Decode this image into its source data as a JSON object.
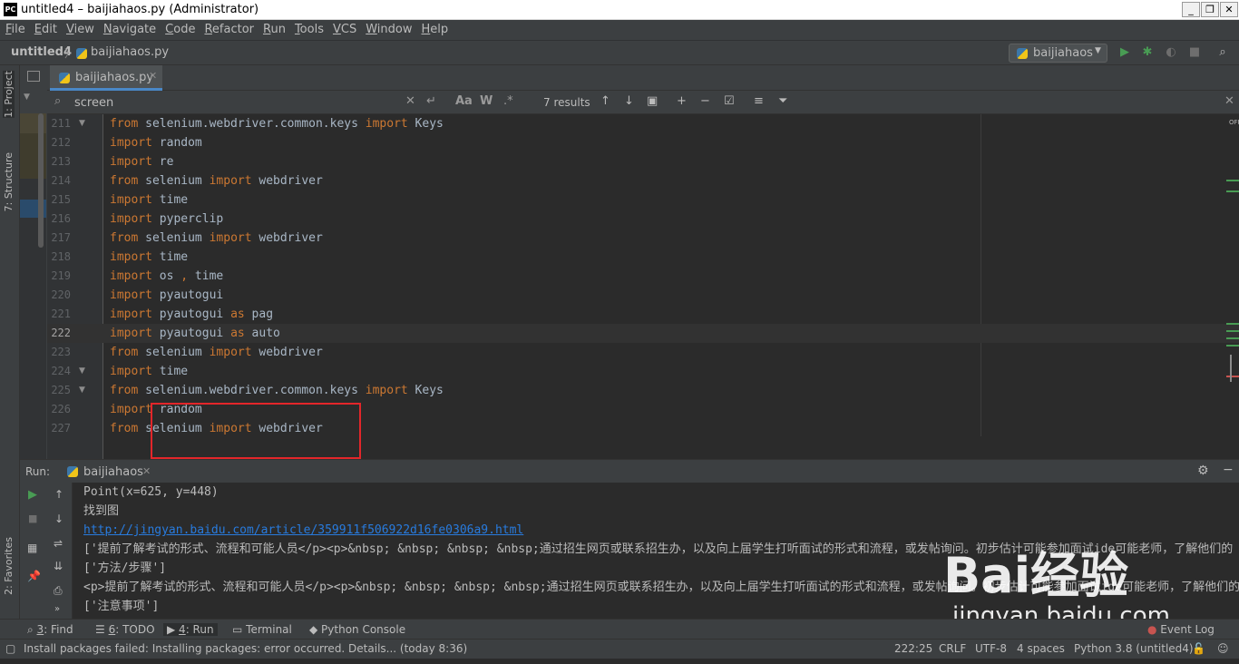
{
  "window": {
    "title": "untitled4 – baijiahaos.py (Administrator)",
    "logo_text": "PC",
    "controls": [
      "_",
      "❐",
      "✕"
    ]
  },
  "menu": [
    {
      "label": "File",
      "u": "F",
      "rest": "ile"
    },
    {
      "label": "Edit",
      "u": "E",
      "rest": "dit"
    },
    {
      "label": "View",
      "u": "V",
      "rest": "iew"
    },
    {
      "label": "Navigate",
      "u": "N",
      "rest": "avigate"
    },
    {
      "label": "Code",
      "u": "C",
      "rest": "ode"
    },
    {
      "label": "Refactor",
      "u": "R",
      "rest": "efactor"
    },
    {
      "label": "Run",
      "u": "R",
      "rest": "un"
    },
    {
      "label": "Tools",
      "u": "T",
      "rest": "ools"
    },
    {
      "label": "VCS",
      "u": "V",
      "rest": "CS"
    },
    {
      "label": "Window",
      "u": "W",
      "rest": "indow"
    },
    {
      "label": "Help",
      "u": "H",
      "rest": "elp"
    }
  ],
  "nav": {
    "project": "untitled4",
    "file": "baijiahaos.py",
    "run_config": "baijiahaos"
  },
  "left_strip": {
    "project_tab": "1: Project",
    "structure_tab": "7: Structure",
    "favorites_tab": "2: Favorites"
  },
  "editor_tab": {
    "label": "baijiahaos.py"
  },
  "search": {
    "query": "screen",
    "results": "7 results",
    "match_case": "Aa",
    "words": "W",
    "regex": ".*"
  },
  "editor": {
    "current_line": 222,
    "off_label": "OFF",
    "lines": [
      {
        "n": "211",
        "parts": [
          [
            "from",
            1
          ],
          [
            " selenium.webdriver.common.keys ",
            0
          ],
          [
            "import",
            1
          ],
          [
            " Keys",
            0
          ]
        ]
      },
      {
        "n": "212",
        "parts": [
          [
            "import",
            1
          ],
          [
            " random",
            0
          ]
        ]
      },
      {
        "n": "213",
        "parts": [
          [
            "import",
            1
          ],
          [
            " re",
            0
          ]
        ]
      },
      {
        "n": "214",
        "parts": [
          [
            "from",
            1
          ],
          [
            " selenium ",
            0
          ],
          [
            "import",
            1
          ],
          [
            " webdriver",
            0
          ]
        ]
      },
      {
        "n": "215",
        "parts": [
          [
            "import",
            1
          ],
          [
            " time",
            0
          ]
        ]
      },
      {
        "n": "216",
        "parts": [
          [
            "import",
            1
          ],
          [
            " pyperclip",
            0
          ]
        ]
      },
      {
        "n": "217",
        "parts": [
          [
            "from",
            1
          ],
          [
            " selenium ",
            0
          ],
          [
            "import",
            1
          ],
          [
            " webdriver",
            0
          ]
        ]
      },
      {
        "n": "218",
        "parts": [
          [
            "import",
            1
          ],
          [
            " time",
            0
          ]
        ]
      },
      {
        "n": "219",
        "parts": [
          [
            "import",
            1
          ],
          [
            " os ",
            0
          ],
          [
            ",",
            1
          ],
          [
            " time",
            0
          ]
        ]
      },
      {
        "n": "220",
        "parts": [
          [
            "import",
            1
          ],
          [
            " pyautogui",
            0
          ]
        ]
      },
      {
        "n": "221",
        "parts": [
          [
            "import",
            1
          ],
          [
            " pyautogui ",
            0
          ],
          [
            "as",
            1
          ],
          [
            " pag",
            0
          ]
        ]
      },
      {
        "n": "222",
        "parts": [
          [
            "import",
            1
          ],
          [
            " pyautogui ",
            0
          ],
          [
            "as",
            1
          ],
          [
            " auto",
            0
          ]
        ]
      },
      {
        "n": "223",
        "parts": [
          [
            "from",
            1
          ],
          [
            " selenium ",
            0
          ],
          [
            "import",
            1
          ],
          [
            " webdriver",
            0
          ]
        ]
      },
      {
        "n": "224",
        "parts": [
          [
            "import",
            1
          ],
          [
            " time",
            0
          ]
        ]
      },
      {
        "n": "225",
        "parts": [
          [
            "from",
            1
          ],
          [
            " selenium.webdriver.common.keys ",
            0
          ],
          [
            "import",
            1
          ],
          [
            " Keys",
            0
          ]
        ]
      },
      {
        "n": "226",
        "parts": [
          [
            "import",
            1
          ],
          [
            " random",
            0
          ]
        ]
      },
      {
        "n": "227",
        "parts": [
          [
            "from",
            1
          ],
          [
            " selenium ",
            0
          ],
          [
            "import",
            1
          ],
          [
            " webdriver",
            0
          ]
        ]
      }
    ]
  },
  "run": {
    "label": "Run:",
    "tab": "baijiahaos",
    "console": [
      {
        "text": "Point(x=625, y=448)",
        "link": false
      },
      {
        "text": "找到图",
        "link": false
      },
      {
        "text": "http://jingyan.baidu.com/article/359911f506922d16fe0306a9.html",
        "link": true
      },
      {
        "text": "['提前了解考试的形式、流程和可能人员</p><p>&nbsp; &nbsp; &nbsp; &nbsp;通过招生网页或联系招生办，以及向上届学生打听面试的形式和流程，或发帖询问。初步估计可能参加面试ide可能老师，了解他们的",
        "link": false
      },
      {
        "text": "['方法/步骤']",
        "link": false
      },
      {
        "text": "<p>提前了解考试的形式、流程和可能人员</p><p>&nbsp; &nbsp; &nbsp; &nbsp;通过招生网页或联系招生办，以及向上届学生打听面试的形式和流程，或发帖询问。初步估计可能参加面试ide可能老师，了解他们的",
        "link": false
      },
      {
        "text": "['注意事项']",
        "link": false
      }
    ]
  },
  "bottom_tabs": [
    {
      "num": "3",
      "label": ": Find",
      "icon": "search-icon"
    },
    {
      "num": "6",
      "label": ": TODO",
      "icon": "todo-icon"
    },
    {
      "num": "4",
      "label": ": Run",
      "icon": "run-icon"
    },
    {
      "num": "",
      "label": "Terminal",
      "icon": "terminal-icon"
    },
    {
      "num": "",
      "label": "Python Console",
      "icon": "python-console-icon"
    }
  ],
  "event_log": "Event Log",
  "status": {
    "message": "Install packages failed: Installing packages: error occurred. Details... (today 8:36)",
    "position": "222:25",
    "line_sep": "CRLF",
    "encoding": "UTF-8",
    "indent": "4 spaces",
    "interpreter": "Python 3.8 (untitled4)"
  },
  "watermark": {
    "brand": "Bai经验",
    "url": "jingyan.baidu.com"
  },
  "colors": {
    "keyword": "#cc7832",
    "text": "#a9b7c6",
    "highlight_box": "#e3262a",
    "link": "#287bde",
    "run_green": "#499c54"
  }
}
